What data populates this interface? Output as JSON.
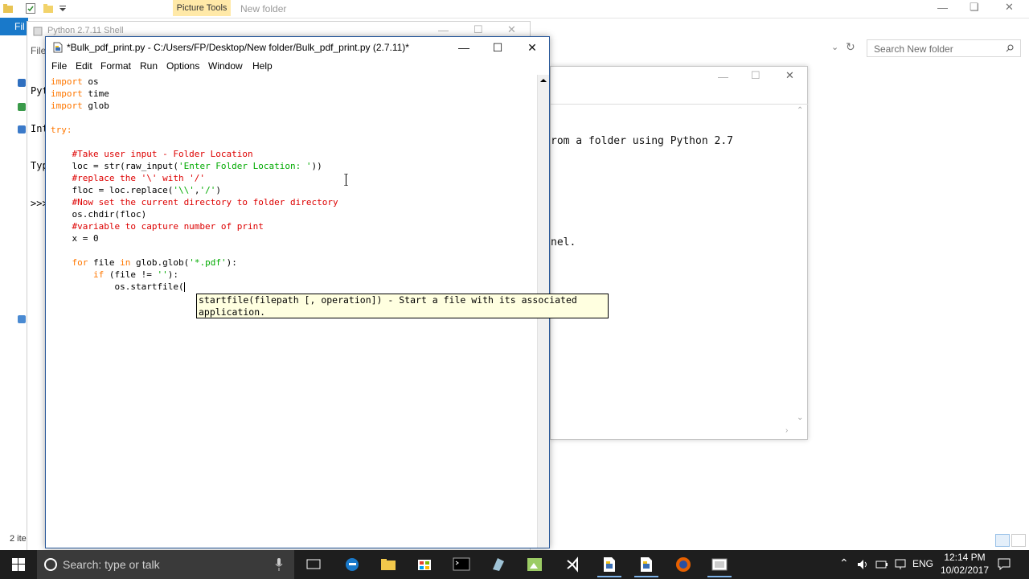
{
  "explorer": {
    "ribbon_context_tab": "Picture Tools",
    "window_title": "New folder",
    "file_tab": "Fil",
    "search_placeholder": "Search New folder",
    "status_text": "2 ite"
  },
  "bg_window": {
    "lines": [
      "rom a folder using Python 2.7",
      "nel."
    ]
  },
  "shell": {
    "title": "Python 2.7.11 Shell",
    "menu_fragment": "File",
    "lines": [
      "Pyt",
      "Int",
      "Typ",
      ">>>"
    ]
  },
  "editor": {
    "title": "*Bulk_pdf_print.py - C:/Users/FP/Desktop/New folder/Bulk_pdf_print.py (2.7.11)*",
    "menu": [
      "File",
      "Edit",
      "Format",
      "Run",
      "Options",
      "Window",
      "Help"
    ],
    "code": {
      "l1_kw": "import",
      "l1_rest": " os",
      "l2_kw": "import",
      "l2_rest": " time",
      "l3_kw": "import",
      "l3_rest": " glob",
      "l5_kw": "try:",
      "l7_cm": "    #Take user input - Folder Location",
      "l8_a": "    loc = str(raw_input(",
      "l8_st": "'Enter Folder Location: '",
      "l8_b": "))",
      "l9_cm": "    #replace the '\\' with '/'",
      "l10_a": "    floc = loc.replace(",
      "l10_st1": "'\\\\'",
      "l10_c": ",",
      "l10_st2": "'/'",
      "l10_b": ")",
      "l11_cm": "    #Now set the current directory to folder directory",
      "l12": "    os.chdir(floc)",
      "l13_cm": "    #variable to capture number of print",
      "l14": "    x = 0",
      "l16_kw1": "    for",
      "l16_a": " file ",
      "l16_kw2": "in",
      "l16_b": " glob.glob(",
      "l16_st": "'*.pdf'",
      "l16_c": "):",
      "l17_kw": "        if",
      "l17_a": " (file != ",
      "l17_st": "''",
      "l17_b": "):",
      "l18": "            os.startfile("
    },
    "calltip_line1": "startfile(filepath [, operation]) - Start a file with its associated",
    "calltip_line2": "application."
  },
  "taskbar": {
    "search_placeholder": "Search: type or talk",
    "language": "ENG",
    "time": "12:14 PM",
    "date": "10/02/2017"
  },
  "colors": {
    "keyword": "#ff7700",
    "comment": "#dd0000",
    "string": "#00aa00",
    "taskbar": "#1e1e1e"
  }
}
